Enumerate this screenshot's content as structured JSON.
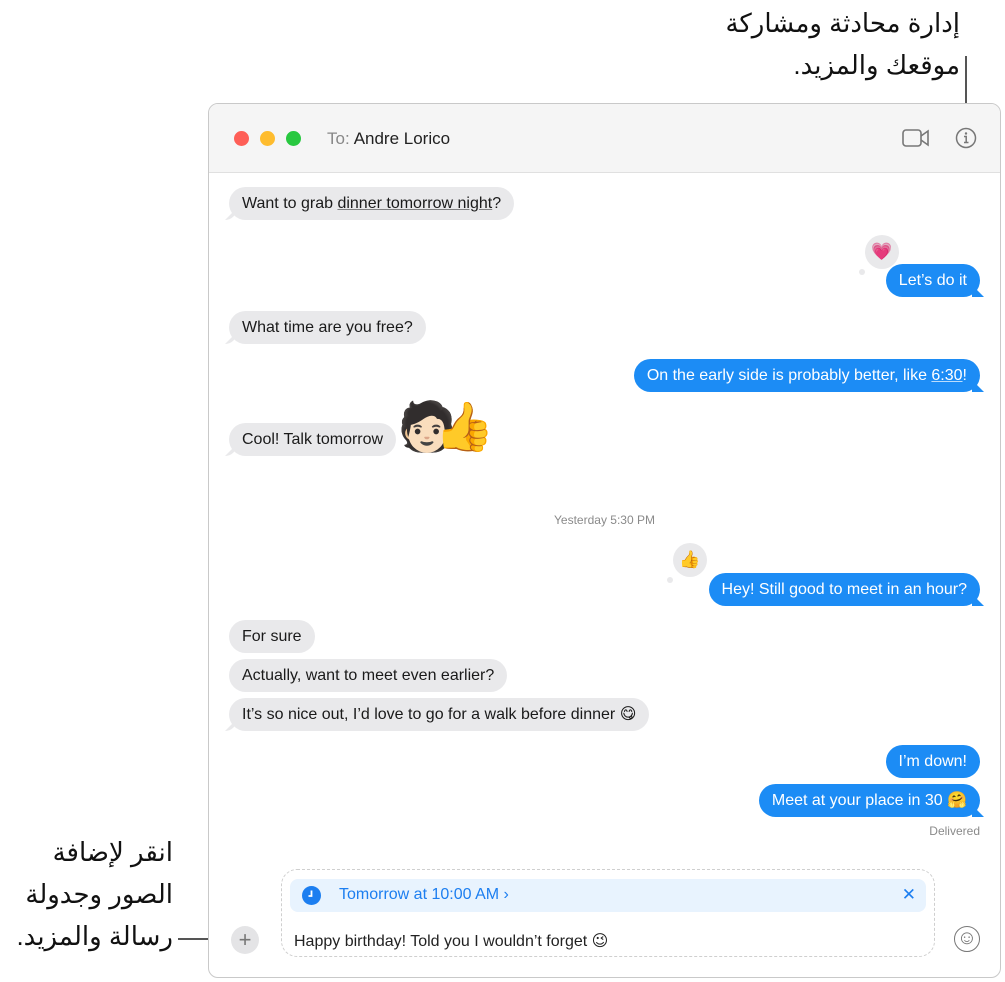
{
  "callouts": {
    "top": [
      "إدارة محادثة ومشاركة",
      "موقعك والمزيد."
    ],
    "bottom": [
      "انقر لإضافة",
      "الصور وجدولة",
      "رسالة والمزيد."
    ]
  },
  "window": {
    "to_label": "To:",
    "recipient": "Andre Lorico",
    "icons": [
      "video-camera-icon",
      "info-icon"
    ]
  },
  "messages": [
    {
      "side": "in",
      "parts": [
        "Want to grab ",
        "dinner tomorrow night",
        "?"
      ]
    },
    {
      "side": "out",
      "text": "Let’s do it",
      "tapback": "💗"
    },
    {
      "side": "in",
      "text": "What time are you free?"
    },
    {
      "side": "out",
      "parts": [
        "On the early side is probably better, like ",
        "6:30",
        "!"
      ]
    },
    {
      "side": "in",
      "text": "Cool! Talk tomorrow",
      "sticker": "🧑🏻👍"
    },
    {
      "side": "out",
      "text": "Hey! Still good to meet in an hour?",
      "tapback": "👍"
    },
    {
      "side": "in",
      "text": "For sure"
    },
    {
      "side": "in",
      "text": "Actually, want to meet even earlier?"
    },
    {
      "side": "in",
      "text": "It’s so nice out, I’d love to go for a walk before dinner 😋"
    },
    {
      "side": "out",
      "text": "I’m down!"
    },
    {
      "side": "out",
      "text": "Meet at your place in 30 🤗"
    }
  ],
  "timestamp": "Yesterday 5:30 PM",
  "delivered": "Delivered",
  "compose": {
    "schedule": "Tomorrow at 10:00 AM",
    "schedule_chevron": "›",
    "close": "✕",
    "text": "Happy birthday! Told you I wouldn’t forget 😉",
    "plus": "+",
    "emoji": "☺"
  },
  "colors": {
    "accent": "#1c8cf5",
    "schedule_bg": "#e8f3fe",
    "red": "#fe5f57",
    "yellow": "#febc2e",
    "green": "#28c840"
  }
}
